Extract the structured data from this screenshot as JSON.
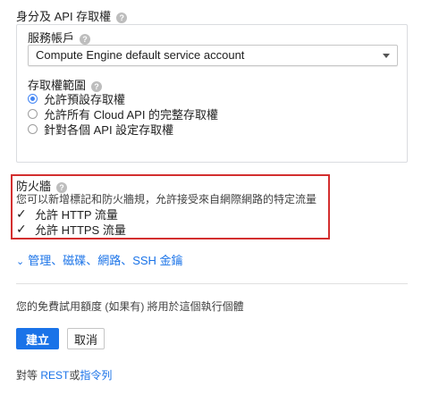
{
  "access": {
    "title": "身分及 API 存取權",
    "service_account_label": "服務帳戶",
    "service_account_value": "Compute Engine default service account",
    "scope_label": "存取權範圍",
    "scope_options": [
      "允許預設存取權",
      "允許所有 Cloud API 的完整存取權",
      "針對各個 API 設定存取權"
    ],
    "scope_selected": 0
  },
  "firewall": {
    "title": "防火牆",
    "description": "您可以新增標記和防火牆規，允許接受來自網際網路的特定流量",
    "http_label": "允許 HTTP 流量",
    "https_label": "允許 HTTPS 流量",
    "http_checked": true,
    "https_checked": true
  },
  "management_link": "管理、磁碟、網路、SSH 金鑰",
  "free_trial_note": "您的免費試用額度 (如果有) 將用於這個執行個體",
  "buttons": {
    "create": "建立",
    "cancel": "取消"
  },
  "footer": {
    "prefix": "對等 ",
    "rest": "REST",
    "or": "或",
    "command_line": "指令列"
  },
  "colors": {
    "accent": "#1a73e8",
    "highlight_border": "#d32f2f"
  },
  "icons": {
    "help": "help-circle-icon",
    "dropdown": "caret-down-icon",
    "expand": "double-chevron-down-icon",
    "check": "checkmark-icon"
  }
}
